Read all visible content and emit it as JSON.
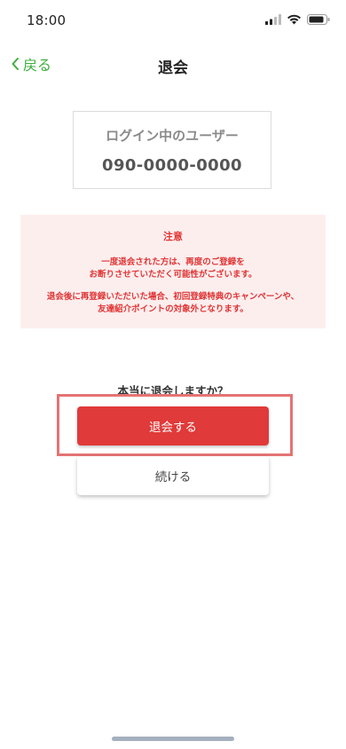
{
  "status_bar": {
    "time": "18:00"
  },
  "nav": {
    "back_label": "戻る",
    "title": "退会"
  },
  "user_card": {
    "label": "ログイン中のユーザー",
    "phone": "090-0000-0000"
  },
  "notice": {
    "title": "注意",
    "line1": "一度退会された方は、再度のご登録を",
    "line2": "お断りさせていただく可能性がございます。",
    "line3": "退会後に再登録いただいた場合、初回登録特典のキャンペーンや、",
    "line4": "友達紹介ポイントの対象外となります。"
  },
  "confirm": {
    "question": "本当に退会しますか？",
    "withdraw_label": "退会する",
    "continue_label": "続ける"
  },
  "colors": {
    "accent_green": "#3dae3d",
    "danger_red": "#e03a3a",
    "notice_bg": "#fdeeee",
    "highlight": "#e57373"
  }
}
